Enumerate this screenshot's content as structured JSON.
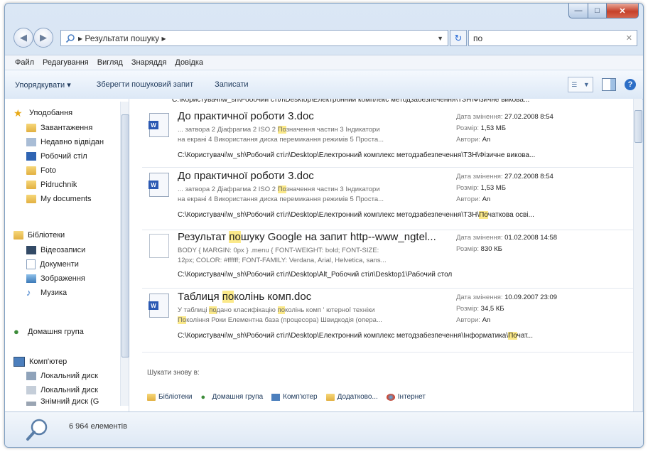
{
  "window": {
    "caption_buttons": {
      "minimize": "—",
      "maximize": "□",
      "close": "✕"
    }
  },
  "address": {
    "path": "Результати пошуку",
    "search_value": "по"
  },
  "menu": [
    "Файл",
    "Редагування",
    "Вигляд",
    "Знаряддя",
    "Довідка"
  ],
  "toolbar": {
    "organize": "Упорядкувати ▾",
    "save_search": "Зберегти пошуковий запит",
    "burn": "Записати"
  },
  "nav": {
    "favorites_header": "Уподобання",
    "favorites": [
      "Завантаження",
      "Недавно відвідан",
      "Робочий стіл",
      "Foto",
      "Pidruchnik",
      "My documents"
    ],
    "libraries_header": "Бібліотеки",
    "libraries": [
      "Відеозаписи",
      "Документи",
      "Зображення",
      "Музика"
    ],
    "homegroup": "Домашня група",
    "computer_header": "Комп'ютер",
    "computer": [
      "Локальний диск",
      "Локальний диск",
      "Знімний диск (G"
    ]
  },
  "results": [
    {
      "title": [
        "До практичної роботи 3.doc"
      ],
      "snippet1": [
        "... затвора 2 Діафрагма 2 ISO 2 ",
        "По",
        "значення частин 3 Індикатори"
      ],
      "snippet2": [
        "на екрані 4 Використання диска перемикання режимів 5 Проста..."
      ],
      "date_label": "Дата змінення: ",
      "date": "27.02.2008 8:54",
      "size_label": "Розмір: ",
      "size": "1,53 МБ",
      "author_label": "Автори: ",
      "author": "An",
      "path": [
        "C:\\Користувачі\\w_sh\\Робочий стіл\\Desktop\\Електронний комплекс методзабезпечення\\ТЗН\\Фізичне викова..."
      ]
    },
    {
      "title": [
        "До практичної роботи 3.doc"
      ],
      "snippet1": [
        "... затвора 2 Діафрагма 2 ISO 2 ",
        "По",
        "значення частин 3 Індикатори"
      ],
      "snippet2": [
        "на екрані 4 Використання диска перемикання режимів 5 Проста..."
      ],
      "date_label": "Дата змінення: ",
      "date": "27.02.2008 8:54",
      "size_label": "Розмір: ",
      "size": "1,53 МБ",
      "author_label": "Автори: ",
      "author": "An",
      "path": [
        "C:\\Користувачі\\w_sh\\Робочий стіл\\Desktop\\Електронний комплекс методзабезпечення\\ТЗН\\",
        "По",
        "чаткова осві..."
      ]
    },
    {
      "title": [
        "Результат ",
        "по",
        "шуку Google на запит http--www_ngtel..."
      ],
      "snippet1": [
        "BODY { MARGIN: 0px } .menu { FONT-WEIGHT: bold; FONT-SIZE:"
      ],
      "snippet2": [
        "12px; COLOR: #ffffff; FONT-FAMILY: Verdana, Arial, Helvetica, sans..."
      ],
      "date_label": "Дата змінення: ",
      "date": "01.02.2008 14:58",
      "size_label": "Розмір: ",
      "size": "830 КБ",
      "author_label": "",
      "author": "",
      "path": [
        "C:\\Користувачі\\w_sh\\Робочий стіл\\Desktop\\Alt_Робочий стіл\\Desktop1\\Рабочий стол"
      ]
    },
    {
      "title": [
        "Таблиця ",
        "по",
        "колінь комп.doc"
      ],
      "snippet1": [
        "У таблиці ",
        "по",
        "дано класифікацію ",
        "по",
        "колінь комп ' ютерної техніки"
      ],
      "snippet2": [
        "",
        "По",
        "коління Роки Елементна база (процесора) Швидкодія (опера..."
      ],
      "date_label": "Дата змінення: ",
      "date": "10.09.2007 23:09",
      "size_label": "Розмір: ",
      "size": "34,5 КБ",
      "author_label": "Автори: ",
      "author": "An",
      "path": [
        "C:\\Користувачі\\w_sh\\Робочий стіл\\Desktop\\Електронний комплекс методзабезпечення\\Інформатика\\",
        "По",
        "чат..."
      ]
    }
  ],
  "search_again": {
    "label": "Шукати знову в:",
    "locations": [
      "Бібліотеки",
      "Домашня група",
      "Комп'ютер",
      "Додатково...",
      "Інтернет"
    ]
  },
  "status": {
    "count": "6 964 елементів"
  },
  "colors": {
    "highlight": "#fbe98a",
    "accent": "#2c6ec6"
  }
}
